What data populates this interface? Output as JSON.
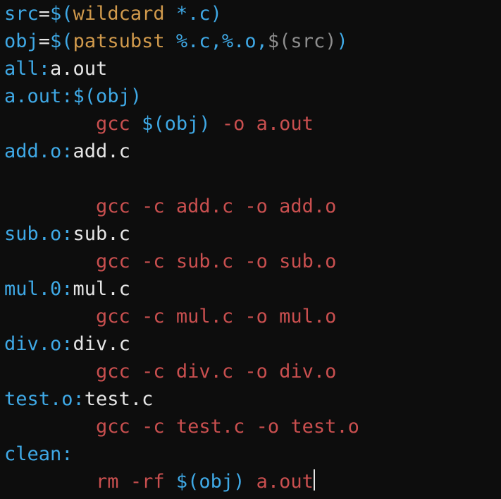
{
  "lines": {
    "l1": {
      "a": "src",
      "b": "=",
      "c": "$(",
      "d": "wildcard",
      "e": " *.c",
      "f": ")"
    },
    "l2": {
      "a": "obj",
      "b": "=",
      "c": "$(",
      "d": "patsubst",
      "e": " %.c,%.o,",
      "f": "$(src)",
      "g": ")"
    },
    "l3": {
      "a": "all:",
      "b": "a.out"
    },
    "l4": {
      "a": "a.out:",
      "b": "$(obj)"
    },
    "l5": {
      "indent": "        ",
      "a": "gcc",
      "b": " $(obj) ",
      "c": "-o a.out"
    },
    "l6": {
      "a": "add.o:",
      "b": "add.c"
    },
    "l7": {
      "blank": ""
    },
    "l8": {
      "indent": "        ",
      "a": "gcc -c add.c -o add.o"
    },
    "l9": {
      "a": "sub.o:",
      "b": "sub.c"
    },
    "l10": {
      "indent": "        ",
      "a": "gcc -c sub.c -o sub.o"
    },
    "l11": {
      "a": "mul.0:",
      "b": "mul.c"
    },
    "l12": {
      "indent": "        ",
      "a": "gcc -c mul.c -o mul.o"
    },
    "l13": {
      "a": "div.o:",
      "b": "div.c"
    },
    "l14": {
      "indent": "        ",
      "a": "gcc -c div.c -o div.o"
    },
    "l15": {
      "a": "test.o:",
      "b": "test.c"
    },
    "l16": {
      "indent": "        ",
      "a": "gcc -c test.c -o test.o"
    },
    "l17": {
      "a": "clean:"
    },
    "l18": {
      "indent": "        ",
      "a": "rm -rf",
      "b": " $(obj) ",
      "c": "a.out"
    }
  }
}
